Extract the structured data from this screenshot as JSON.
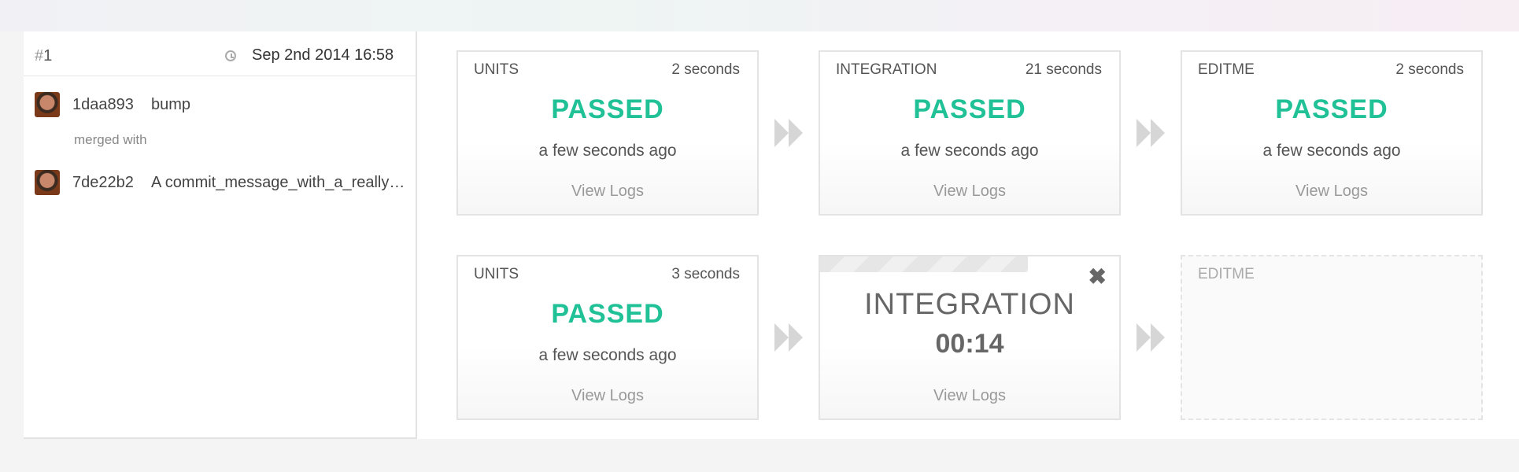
{
  "build": {
    "number_prefix": "#",
    "number": "1",
    "date": "Sep 2nd 2014 16:58"
  },
  "commits": [
    {
      "sha": "1daa893",
      "message": "bump"
    },
    {
      "sha": "7de22b2",
      "message": "A commit_message_with_a_really_long_name_that_gets_truncated"
    }
  ],
  "merged_label": "merged with",
  "rows": [
    {
      "stages": [
        {
          "label": "UNITS",
          "duration": "2 seconds",
          "status": "PASSED",
          "time_ago": "a few seconds ago",
          "logs": "View Logs"
        },
        {
          "label": "INTEGRATION",
          "duration": "21 seconds",
          "status": "PASSED",
          "time_ago": "a few seconds ago",
          "logs": "View Logs"
        },
        {
          "label": "EDITME",
          "duration": "2 seconds",
          "status": "PASSED",
          "time_ago": "a few seconds ago",
          "logs": "View Logs"
        }
      ]
    },
    {
      "stages": [
        {
          "label": "UNITS",
          "duration": "3 seconds",
          "status": "PASSED",
          "time_ago": "a few seconds ago",
          "logs": "View Logs"
        },
        {
          "label": "INTEGRATION",
          "elapsed": "00:14",
          "logs": "View Logs",
          "state": "running"
        },
        {
          "label": "EDITME",
          "state": "pending"
        }
      ]
    }
  ],
  "colors": {
    "passed": "#21c197",
    "arrow": "#d6d6d6"
  }
}
